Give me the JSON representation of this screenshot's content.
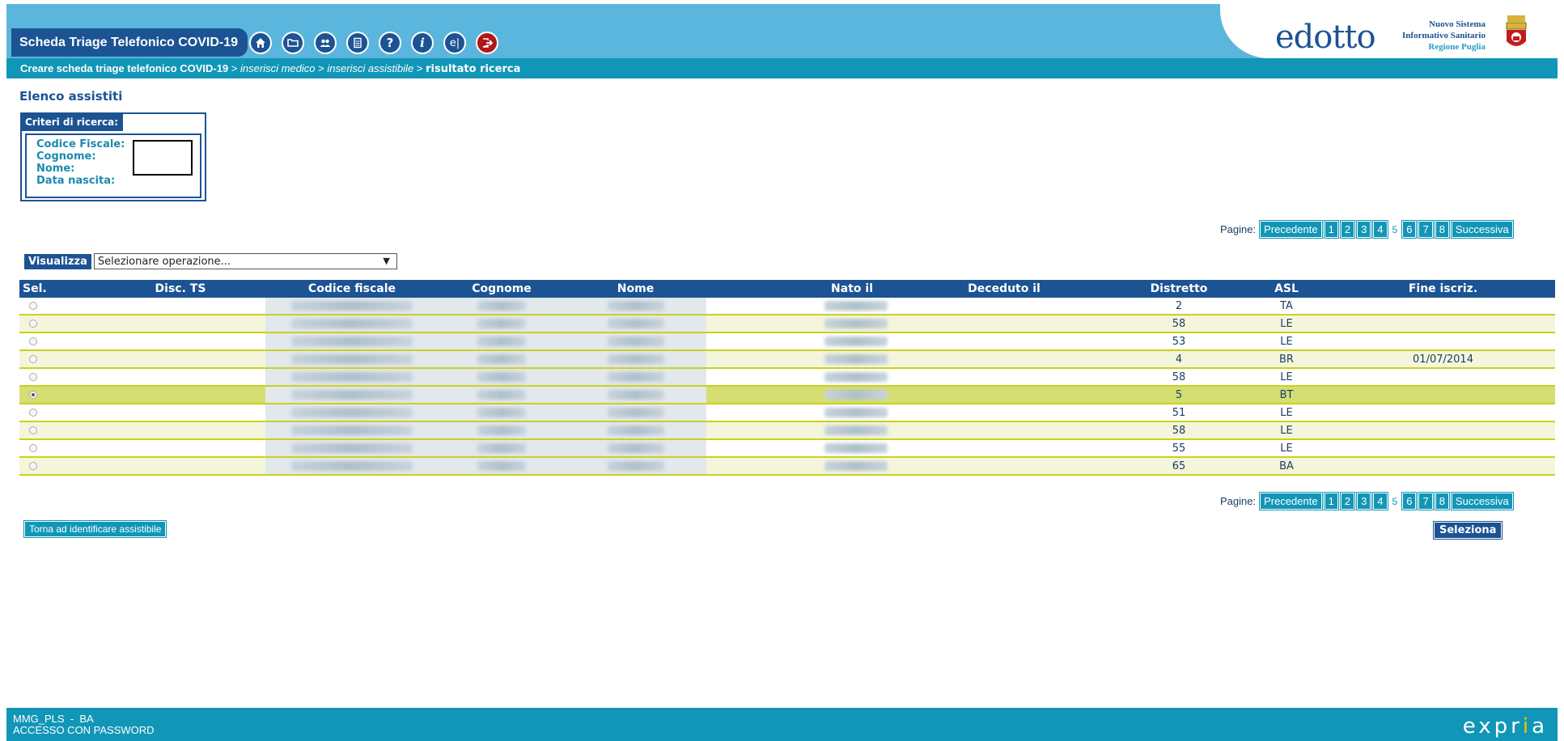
{
  "header": {
    "app_title": "Scheda Triage Telefonico COVID-19",
    "icons": [
      "home-icon",
      "folder-icon",
      "users-icon",
      "document-icon",
      "help-icon",
      "info-icon",
      "el-icon",
      "logout-icon"
    ],
    "logo_brand": "edotto",
    "logo_line1": "Nuovo Sistema",
    "logo_line2": "Informativo Sanitario",
    "logo_line3": "Regione Puglia"
  },
  "breadcrumb": {
    "step1": "Creare scheda triage telefonico COVID-19",
    "sep1": " > ",
    "step2": "inserisci medico",
    "sep2": " > ",
    "step3": "inserisci assistibile",
    "sep3": " > ",
    "current": "risultato ricerca"
  },
  "page_title": "Elenco assistiti",
  "criteria": {
    "tab": "Criteri di ricerca:",
    "labels": [
      "Codice Fiscale:",
      "Cognome:",
      "Nome:",
      "Data nascita:"
    ]
  },
  "pager": {
    "label": "Pagine:",
    "prev": "Precedente",
    "pages": [
      "1",
      "2",
      "3",
      "4"
    ],
    "current": "5",
    "pages_after": [
      "6",
      "7",
      "8"
    ],
    "next": "Successiva"
  },
  "visualizza": {
    "button": "Visualizza",
    "select_value": "Selezionare operazione...",
    "arrow": "▼"
  },
  "table": {
    "headers": [
      "Sel.",
      "Disc. TS",
      "Codice fiscale",
      "Cognome",
      "Nome",
      "Nato il",
      "Deceduto il",
      "Distretto",
      "ASL",
      "Fine iscriz."
    ],
    "rows": [
      {
        "distretto": "2",
        "asl": "TA",
        "fine": ""
      },
      {
        "distretto": "58",
        "asl": "LE",
        "fine": ""
      },
      {
        "distretto": "53",
        "asl": "LE",
        "fine": ""
      },
      {
        "distretto": "4",
        "asl": "BR",
        "fine": "01/07/2014"
      },
      {
        "distretto": "58",
        "asl": "LE",
        "fine": ""
      },
      {
        "distretto": "5",
        "asl": "BT",
        "fine": ""
      },
      {
        "distretto": "51",
        "asl": "LE",
        "fine": ""
      },
      {
        "distretto": "58",
        "asl": "LE",
        "fine": ""
      },
      {
        "distretto": "55",
        "asl": "LE",
        "fine": ""
      },
      {
        "distretto": "65",
        "asl": "BA",
        "fine": ""
      }
    ],
    "selected_row": 5
  },
  "buttons": {
    "back": "Torna ad identificare assistibile",
    "select": "Seleziona"
  },
  "footer": {
    "user": "MMG_PLS  -  BA",
    "access": "ACCESSO CON PASSWORD",
    "brand_a": "expr",
    "brand_b": "i",
    "brand_c": "a"
  },
  "colors": {
    "header_bg": "#5ab6dc",
    "navy": "#1c5393",
    "teal": "#1296b7",
    "row_line": "#c9d21a",
    "selected_row": "#d4de73"
  }
}
